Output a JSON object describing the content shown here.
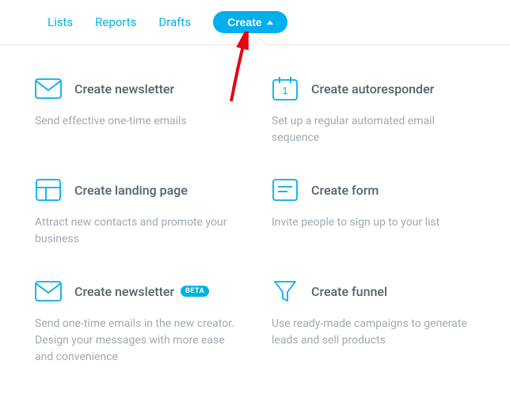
{
  "nav": {
    "lists": "Lists",
    "reports": "Reports",
    "drafts": "Drafts",
    "create": "Create"
  },
  "cards": {
    "newsletter": {
      "title": "Create newsletter",
      "desc": "Send effective one-time emails"
    },
    "autoresponder": {
      "title": "Create autoresponder",
      "desc": "Set up a regular automated email sequence"
    },
    "landingpage": {
      "title": "Create landing page",
      "desc": "Attract new contacts and promote your business"
    },
    "form": {
      "title": "Create form",
      "desc": "Invite people to sign up to your list"
    },
    "newsletter_beta": {
      "title": "Create newsletter",
      "badge": "BETA",
      "desc": "Send one-time emails in the new creator. Design your messages with more ease and convenience"
    },
    "funnel": {
      "title": "Create funnel",
      "desc": "Use ready-made campaigns to generate leads and sell products"
    }
  },
  "colors": {
    "accent": "#00afec"
  }
}
